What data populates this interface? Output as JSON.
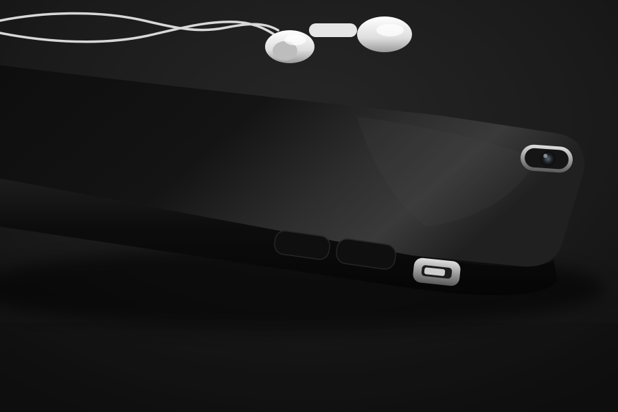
{
  "scene": {
    "subjects": [
      "phone-case",
      "earbuds",
      "earbud-cable"
    ],
    "colors": {
      "surface": "#1a1a1a",
      "case_leather": "#141414",
      "case_highlight": "#3a3a3a",
      "earbud_white": "#e8e8e8",
      "metal_trim": "#b0b0b0"
    }
  }
}
